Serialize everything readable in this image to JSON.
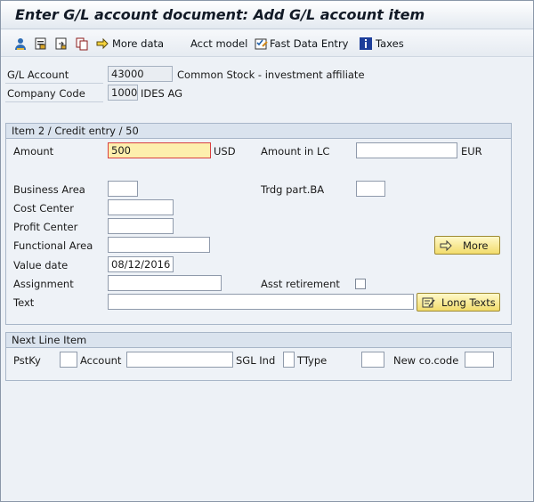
{
  "title": "Enter G/L account document: Add G/L account item",
  "toolbar": {
    "more_data": "More data",
    "acct_model": "Acct model",
    "fast_data_entry": "Fast Data Entry",
    "taxes": "Taxes"
  },
  "header": {
    "gl_account_label": "G/L Account",
    "gl_account_value": "43000",
    "gl_account_desc": "Common Stock - investment affiliate",
    "company_code_label": "Company Code",
    "company_code_value": "1000",
    "company_code_desc": "IDES AG"
  },
  "item": {
    "title": "Item 2 / Credit entry / 50",
    "amount_label": "Amount",
    "amount_value": "500",
    "amount_currency": "USD",
    "amount_lc_label": "Amount in LC",
    "amount_lc_value": "",
    "amount_lc_currency": "EUR",
    "business_area_label": "Business Area",
    "trdg_part_label": "Trdg part.BA",
    "cost_center_label": "Cost Center",
    "profit_center_label": "Profit Center",
    "functional_area_label": "Functional Area",
    "value_date_label": "Value date",
    "value_date_value": "08/12/2016",
    "assignment_label": "Assignment",
    "asst_retirement_label": "Asst retirement",
    "text_label": "Text",
    "more_button": "More",
    "long_texts_button": "Long Texts"
  },
  "next_line": {
    "title": "Next Line Item",
    "pstky_label": "PstKy",
    "account_label": "Account",
    "sgl_ind_label": "SGL Ind",
    "ttype_label": "TType",
    "new_cocode_label": "New co.code"
  },
  "colors": {
    "window_bg": "#eef2f7",
    "active_field_bg": "#fdefad",
    "button_yellow": "#f2dc6c",
    "group_header": "#dae3ee"
  }
}
